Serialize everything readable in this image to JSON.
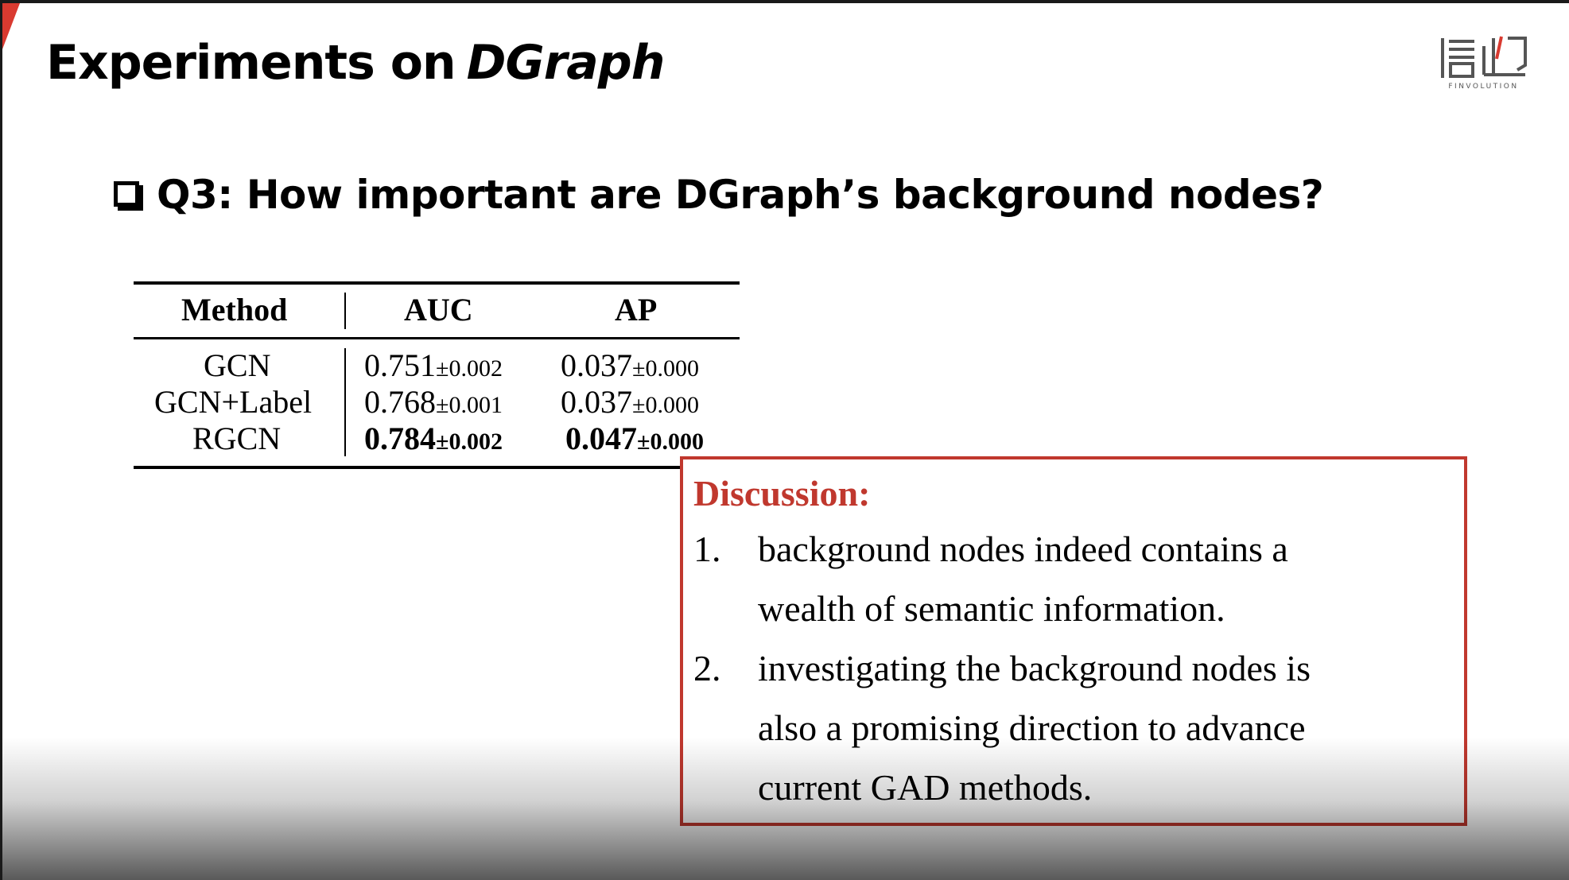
{
  "slide": {
    "title_main": "Experiments on",
    "title_italic": "DGraph",
    "logo_text": "FINVOLUTION",
    "question": "Q3: How important are DGraph’s background nodes?"
  },
  "table": {
    "headers": [
      "Method",
      "AUC",
      "AP"
    ],
    "rows": [
      {
        "method": "GCN",
        "auc": "0.751",
        "auc_pm": "±0.002",
        "ap": "0.037",
        "ap_pm": "±0.000",
        "bold": false
      },
      {
        "method": "GCN+Label",
        "auc": "0.768",
        "auc_pm": "±0.001",
        "ap": "0.037",
        "ap_pm": "±0.000",
        "bold": false
      },
      {
        "method": "RGCN",
        "auc": "0.784",
        "auc_pm": "±0.002",
        "ap": "0.047",
        "ap_pm": "±0.000",
        "bold": true
      }
    ]
  },
  "discussion": {
    "title": "Discussion:",
    "items": [
      {
        "num": "1.",
        "lines": [
          "background nodes indeed contains a",
          "wealth of semantic information."
        ]
      },
      {
        "num": "2.",
        "lines": [
          "investigating the background nodes is",
          "also a promising direction  to advance",
          "current GAD methods."
        ]
      }
    ]
  },
  "colors": {
    "accent_red": "#c0382e",
    "corner_red": "#d93a30"
  }
}
